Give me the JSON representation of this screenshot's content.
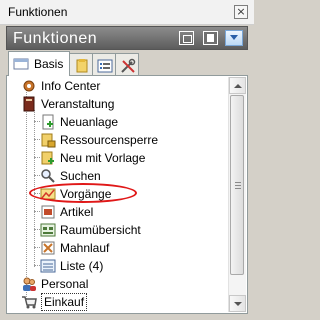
{
  "window": {
    "title": "Funktionen",
    "close_glyph": "×"
  },
  "header": {
    "title": "Funktionen",
    "buttons": [
      "minimize-panel",
      "restore-panel",
      "pin-panel"
    ]
  },
  "tabs": [
    {
      "label": "Basis",
      "icon": "tab-basis-icon",
      "active": true
    },
    {
      "label": "",
      "icon": "folder-tab-icon",
      "active": false
    },
    {
      "label": "",
      "icon": "list-tab-icon",
      "active": false
    },
    {
      "label": "",
      "icon": "tools-tab-icon",
      "active": false
    }
  ],
  "tree": {
    "items": [
      {
        "label": "Info Center",
        "icon": "gear-cog-icon",
        "level": 0
      },
      {
        "label": "Veranstaltung",
        "icon": "book-icon",
        "level": 0
      },
      {
        "label": "Neuanlage",
        "icon": "new-document-icon",
        "level": 1
      },
      {
        "label": "Ressourcensperre",
        "icon": "lock-folder-icon",
        "level": 1
      },
      {
        "label": "Neu mit Vorlage",
        "icon": "template-icon",
        "level": 1
      },
      {
        "label": "Suchen",
        "icon": "magnifier-icon",
        "level": 1
      },
      {
        "label": "Vorgänge",
        "icon": "processes-icon",
        "level": 1,
        "highlighted": true
      },
      {
        "label": "Artikel",
        "icon": "article-icon",
        "level": 1
      },
      {
        "label": "Raumübersicht",
        "icon": "room-overview-icon",
        "level": 1
      },
      {
        "label": "Mahnlauf",
        "icon": "dunning-icon",
        "level": 1
      },
      {
        "label": "Liste (4)",
        "icon": "list-icon",
        "level": 1
      },
      {
        "label": "Personal",
        "icon": "people-icon",
        "level": 0
      },
      {
        "label": "Einkauf",
        "icon": "cart-icon",
        "level": 0,
        "selected": true
      }
    ]
  },
  "colors": {
    "header_bg": "#6e6e6e",
    "highlight": "#e01818",
    "panel_bg": "#ffffff"
  }
}
